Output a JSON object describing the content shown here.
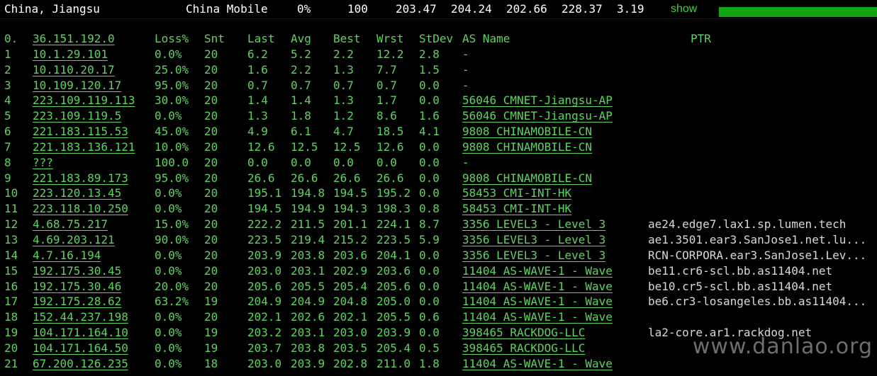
{
  "summary": {
    "location": "China, Jiangsu",
    "isp": "China Mobile",
    "loss": "0%",
    "sent": "100",
    "last": "203.47",
    "avg": "204.24",
    "best": "202.66",
    "worst": "228.37",
    "stdev": "3.19",
    "show_label": "show",
    "bar_fraction": 1.0
  },
  "header": {
    "idx": "0.",
    "host": "36.151.192.0",
    "loss": "Loss%",
    "snt": "Snt",
    "last": "Last",
    "avg": "Avg",
    "best": "Best",
    "wrst": "Wrst",
    "stdev": "StDev",
    "as": "AS Name",
    "ptr": "PTR"
  },
  "hops": [
    {
      "idx": "1",
      "host": "10.1.29.101",
      "loss": "0.0%",
      "snt": "20",
      "last": "6.2",
      "avg": "5.2",
      "best": "2.2",
      "wrst": "12.2",
      "stdev": "2.8",
      "as": "-",
      "ptr": ""
    },
    {
      "idx": "2",
      "host": "10.110.20.17",
      "loss": "25.0%",
      "snt": "20",
      "last": "1.6",
      "avg": "2.2",
      "best": "1.3",
      "wrst": "7.7",
      "stdev": "1.5",
      "as": "-",
      "ptr": ""
    },
    {
      "idx": "3",
      "host": "10.109.120.17",
      "loss": "95.0%",
      "snt": "20",
      "last": "0.7",
      "avg": "0.7",
      "best": "0.7",
      "wrst": "0.7",
      "stdev": "0.0",
      "as": "-",
      "ptr": ""
    },
    {
      "idx": "4",
      "host": "223.109.119.113",
      "loss": "30.0%",
      "snt": "20",
      "last": "1.4",
      "avg": "1.4",
      "best": "1.3",
      "wrst": "1.7",
      "stdev": "0.0",
      "as": "56046 CMNET-Jiangsu-AP",
      "ptr": ""
    },
    {
      "idx": "5",
      "host": "223.109.119.5",
      "loss": "0.0%",
      "snt": "20",
      "last": "1.3",
      "avg": "1.8",
      "best": "1.2",
      "wrst": "8.6",
      "stdev": "1.6",
      "as": "56046 CMNET-Jiangsu-AP",
      "ptr": ""
    },
    {
      "idx": "6",
      "host": "221.183.115.53",
      "loss": "45.0%",
      "snt": "20",
      "last": "4.9",
      "avg": "6.1",
      "best": "4.7",
      "wrst": "18.5",
      "stdev": "4.1",
      "as": "9808  CHINAMOBILE-CN",
      "ptr": ""
    },
    {
      "idx": "7",
      "host": "221.183.136.121",
      "loss": "10.0%",
      "snt": "20",
      "last": "12.6",
      "avg": "12.5",
      "best": "12.5",
      "wrst": "12.6",
      "stdev": "0.0",
      "as": "9808  CHINAMOBILE-CN",
      "ptr": ""
    },
    {
      "idx": "8",
      "host": "???",
      "loss": "100.0",
      "snt": "20",
      "last": "0.0",
      "avg": "0.0",
      "best": "0.0",
      "wrst": "0.0",
      "stdev": "0.0",
      "as": "-",
      "ptr": ""
    },
    {
      "idx": "9",
      "host": "221.183.89.173",
      "loss": "95.0%",
      "snt": "20",
      "last": "26.6",
      "avg": "26.6",
      "best": "26.6",
      "wrst": "26.6",
      "stdev": "0.0",
      "as": "9808  CHINAMOBILE-CN",
      "ptr": ""
    },
    {
      "idx": "10",
      "host": "223.120.13.45",
      "loss": "0.0%",
      "snt": "20",
      "last": "195.1",
      "avg": "194.8",
      "best": "194.5",
      "wrst": "195.2",
      "stdev": "0.0",
      "as": "58453 CMI-INT-HK",
      "ptr": ""
    },
    {
      "idx": "11",
      "host": "223.118.10.250",
      "loss": "0.0%",
      "snt": "20",
      "last": "194.5",
      "avg": "194.9",
      "best": "194.3",
      "wrst": "198.3",
      "stdev": "0.8",
      "as": "58453 CMI-INT-HK",
      "ptr": ""
    },
    {
      "idx": "12",
      "host": "4.68.75.217",
      "loss": "15.0%",
      "snt": "20",
      "last": "222.2",
      "avg": "211.5",
      "best": "201.1",
      "wrst": "224.1",
      "stdev": "8.7",
      "as": "3356  LEVEL3 - Level 3",
      "ptr": "ae24.edge7.lax1.sp.lumen.tech"
    },
    {
      "idx": "13",
      "host": "4.69.203.121",
      "loss": "90.0%",
      "snt": "20",
      "last": "223.5",
      "avg": "219.4",
      "best": "215.2",
      "wrst": "223.5",
      "stdev": "5.9",
      "as": "3356  LEVEL3 - Level 3",
      "ptr": "ae1.3501.ear3.SanJose1.net.lu..."
    },
    {
      "idx": "14",
      "host": "4.7.16.194",
      "loss": "0.0%",
      "snt": "20",
      "last": "203.9",
      "avg": "203.8",
      "best": "203.6",
      "wrst": "204.1",
      "stdev": "0.0",
      "as": "3356  LEVEL3 - Level 3",
      "ptr": "RCN-CORPORA.ear3.SanJose1.Lev..."
    },
    {
      "idx": "15",
      "host": "192.175.30.45",
      "loss": "0.0%",
      "snt": "20",
      "last": "203.0",
      "avg": "203.1",
      "best": "202.9",
      "wrst": "203.6",
      "stdev": "0.0",
      "as": "11404 AS-WAVE-1 - Wave",
      "ptr": "be11.cr6-scl.bb.as11404.net"
    },
    {
      "idx": "16",
      "host": "192.175.30.46",
      "loss": "20.0%",
      "snt": "20",
      "last": "205.6",
      "avg": "205.5",
      "best": "205.4",
      "wrst": "205.6",
      "stdev": "0.0",
      "as": "11404 AS-WAVE-1 - Wave",
      "ptr": "be10.cr5-scl.bb.as11404.net"
    },
    {
      "idx": "17",
      "host": "192.175.28.62",
      "loss": "63.2%",
      "snt": "19",
      "last": "204.9",
      "avg": "204.9",
      "best": "204.8",
      "wrst": "205.0",
      "stdev": "0.0",
      "as": "11404 AS-WAVE-1 - Wave",
      "ptr": "be6.cr3-losangeles.bb.as11404..."
    },
    {
      "idx": "18",
      "host": "152.44.237.198",
      "loss": "0.0%",
      "snt": "20",
      "last": "202.1",
      "avg": "202.6",
      "best": "202.1",
      "wrst": "205.5",
      "stdev": "0.6",
      "as": "11404 AS-WAVE-1 - Wave",
      "ptr": ""
    },
    {
      "idx": "19",
      "host": "104.171.164.10",
      "loss": "0.0%",
      "snt": "19",
      "last": "203.2",
      "avg": "203.1",
      "best": "203.0",
      "wrst": "203.9",
      "stdev": "0.0",
      "as": "398465 RACKDOG-LLC",
      "ptr": "la2-core.ar1.rackdog.net"
    },
    {
      "idx": "20",
      "host": "104.171.164.50",
      "loss": "0.0%",
      "snt": "19",
      "last": "203.7",
      "avg": "203.8",
      "best": "203.5",
      "wrst": "205.4",
      "stdev": "0.5",
      "as": "398465 RACKDOG-LLC",
      "ptr": ""
    },
    {
      "idx": "21",
      "host": "67.200.126.235",
      "loss": "0.0%",
      "snt": "18",
      "last": "203.0",
      "avg": "203.9",
      "best": "202.8",
      "wrst": "211.0",
      "stdev": "1.8",
      "as": "11404 AS-WAVE-1 - Wave",
      "ptr": ""
    }
  ],
  "watermark": "www.danlao.org",
  "colors": {
    "background": "#000000",
    "text_green": "#5fd35f",
    "summary_text": "#ffffff",
    "bar_green": "#13a413",
    "ptr_text": "#d8d8d8"
  }
}
